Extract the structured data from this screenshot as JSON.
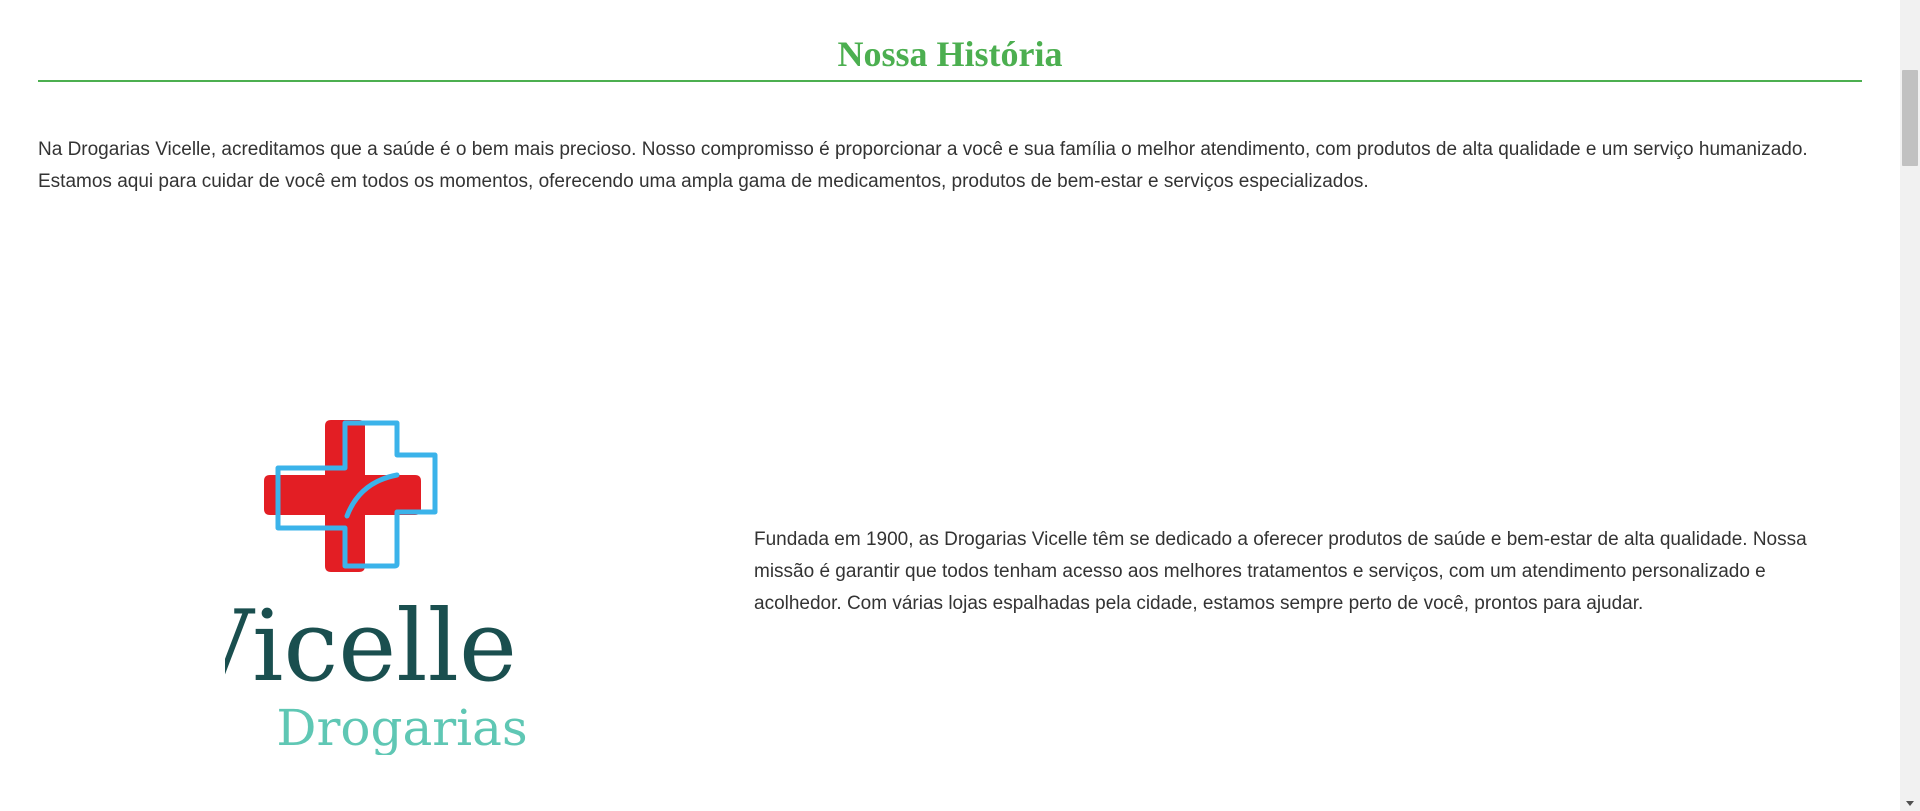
{
  "section": {
    "title": "Nossa História"
  },
  "intro": {
    "text": "Na Drogarias Vicelle, acreditamos que a saúde é o bem mais precioso. Nosso compromisso é proporcionar a você e sua família o melhor atendimento, com produtos de alta qualidade e um serviço humanizado. Estamos aqui para cuidar de você em todos os momentos, oferecendo uma ampla gama de medicamentos, produtos de bem-estar e serviços especializados."
  },
  "logo": {
    "name": "Vicelle",
    "tagline": "Drogarias",
    "colors": {
      "cross_red": "#e31e24",
      "cross_outline_blue": "#3bb3ea",
      "name_dark": "#1a4f4f",
      "tagline_teal": "#5fc7b4"
    }
  },
  "story": {
    "text": "Fundada em 1900, as Drogarias Vicelle têm se dedicado a oferecer produtos de saúde e bem-estar de alta qualidade. Nossa missão é garantir que todos tenham acesso aos melhores tratamentos e serviços, com um atendimento personalizado e acolhedor. Com várias lojas espalhadas pela cidade, estamos sempre perto de você, prontos para ajudar."
  },
  "theme": {
    "accent": "#4caf50",
    "body_text": "#333333"
  }
}
